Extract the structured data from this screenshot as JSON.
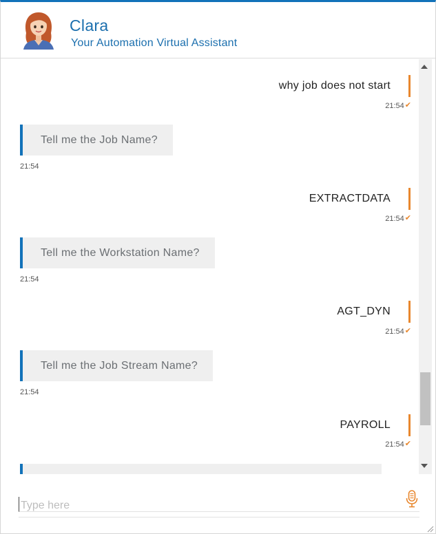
{
  "header": {
    "bot_name": "Clara",
    "bot_subtitle": "Your Automation Virtual Assistant",
    "avatar_icon": "female-assistant-avatar-icon"
  },
  "conversation": [
    {
      "sender": "user",
      "text": "why job does not start",
      "time": "21:54",
      "status_icon": "double-check-icon"
    },
    {
      "sender": "bot",
      "text": "Tell me the Job Name?",
      "time": "21:54"
    },
    {
      "sender": "user",
      "text": "EXTRACTDATA",
      "time": "21:54",
      "status_icon": "double-check-icon"
    },
    {
      "sender": "bot",
      "text": "Tell me the Workstation Name?",
      "time": "21:54"
    },
    {
      "sender": "user",
      "text": "AGT_DYN",
      "time": "21:54",
      "status_icon": "double-check-icon"
    },
    {
      "sender": "bot",
      "text": "Tell me the Job Stream Name?",
      "time": "21:54"
    },
    {
      "sender": "user",
      "text": "PAYROLL",
      "time": "21:54",
      "status_icon": "double-check-icon"
    }
  ],
  "input": {
    "placeholder": "Type here",
    "value": "",
    "mic_icon": "microphone-icon"
  },
  "colors": {
    "accent_blue": "#1272b9",
    "user_accent_orange": "#e8872e",
    "bot_bubble_bg": "#efefef"
  }
}
